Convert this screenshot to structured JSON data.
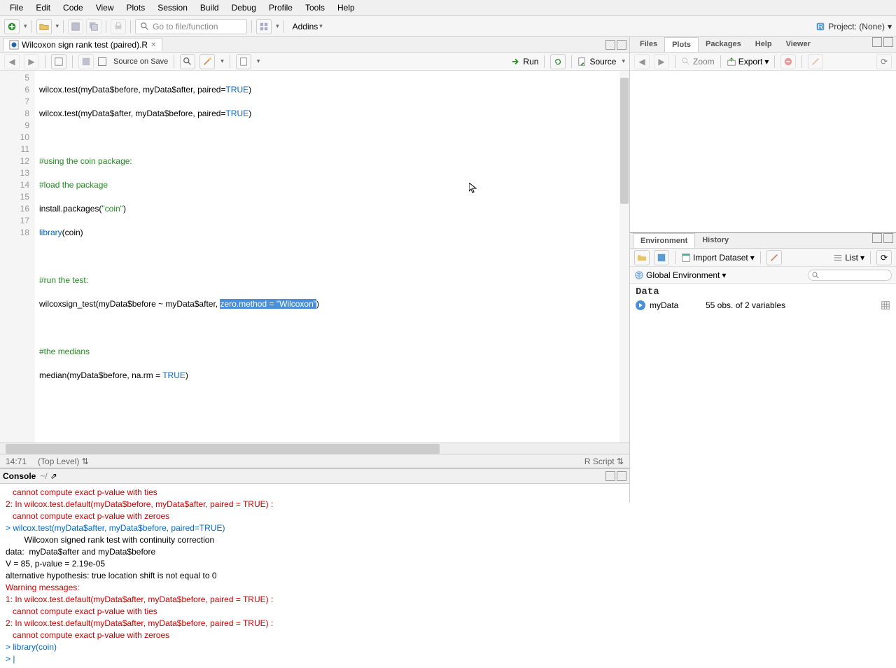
{
  "menu": [
    "File",
    "Edit",
    "Code",
    "View",
    "Plots",
    "Session",
    "Build",
    "Debug",
    "Profile",
    "Tools",
    "Help"
  ],
  "toolbar": {
    "goto_placeholder": "Go to file/function",
    "addins": "Addins",
    "project": "Project: (None)"
  },
  "editor": {
    "tab_title": "Wilcoxon sign rank test (paired).R",
    "source_on_save": "Source on Save",
    "run": "Run",
    "source": "Source",
    "lines": {
      "5": "wilcox.test(myData$before, myData$after, paired=TRUE)",
      "6": "wilcox.test(myData$after, myData$before, paired=TRUE)",
      "7": "",
      "8": "#using the coin package:",
      "9": "#load the package",
      "10_a": "install.packages(",
      "10_b": "\"coin\"",
      "10_c": ")",
      "11_a": "library",
      "11_b": "(coin)",
      "12": "",
      "13": "#run the test:",
      "14_a": "wilcoxsign_test(myData$before ~ myData$after, ",
      "14_sel": "zero.method = \"Wilcoxon\"",
      "14_b": ")",
      "15": "",
      "16": "#the medians",
      "17_a": "median(myData$before, na.rm = ",
      "17_b": "TRUE",
      "17_c": ")",
      "18": ""
    },
    "cursor_pos": "14:71",
    "scope": "(Top Level)",
    "lang": "R Script"
  },
  "console": {
    "title": "Console",
    "path": "~/",
    "lines": [
      {
        "t": "err",
        "v": "   cannot compute exact p-value with ties"
      },
      {
        "t": "err",
        "v": "2: In wilcox.test.default(myData$before, myData$after, paired = TRUE) :"
      },
      {
        "t": "err",
        "v": "   cannot compute exact p-value with zeroes"
      },
      {
        "t": "in",
        "v": "> wilcox.test(myData$after, myData$before, paired=TRUE)"
      },
      {
        "t": "out",
        "v": ""
      },
      {
        "t": "out",
        "v": "        Wilcoxon signed rank test with continuity correction"
      },
      {
        "t": "out",
        "v": ""
      },
      {
        "t": "out",
        "v": "data:  myData$after and myData$before"
      },
      {
        "t": "out",
        "v": "V = 85, p-value = 2.19e-05"
      },
      {
        "t": "out",
        "v": "alternative hypothesis: true location shift is not equal to 0"
      },
      {
        "t": "out",
        "v": ""
      },
      {
        "t": "err",
        "v": "Warning messages:"
      },
      {
        "t": "err",
        "v": "1: In wilcox.test.default(myData$after, myData$before, paired = TRUE) :"
      },
      {
        "t": "err",
        "v": "   cannot compute exact p-value with ties"
      },
      {
        "t": "err",
        "v": "2: In wilcox.test.default(myData$after, myData$before, paired = TRUE) :"
      },
      {
        "t": "err",
        "v": "   cannot compute exact p-value with zeroes"
      },
      {
        "t": "in",
        "v": "> library(coin)"
      },
      {
        "t": "in",
        "v": "> |"
      }
    ]
  },
  "right_top": {
    "tabs": [
      "Files",
      "Plots",
      "Packages",
      "Help",
      "Viewer"
    ],
    "active": 1,
    "zoom": "Zoom",
    "export": "Export"
  },
  "right_bottom": {
    "tabs": [
      "Environment",
      "History"
    ],
    "active": 0,
    "import": "Import Dataset",
    "list": "List",
    "global_env": "Global Environment",
    "data_header": "Data",
    "var_name": "myData",
    "var_desc": "55 obs. of 2 variables"
  }
}
